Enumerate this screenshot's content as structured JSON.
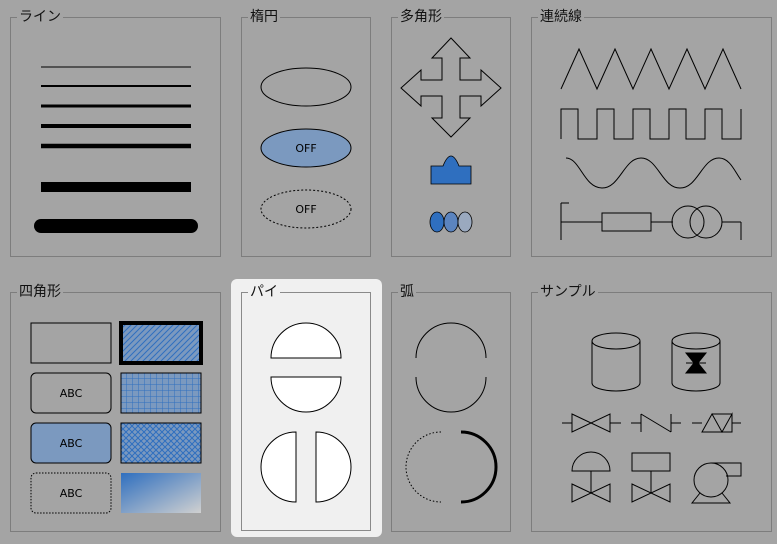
{
  "palette": {
    "background": "#a4a4a4",
    "selected_background": "#f0f0f0",
    "accent_blue": "#2f6fbf",
    "steel_blue": "#7b99bf"
  },
  "panels": {
    "line": {
      "title": "ライン"
    },
    "ellipse": {
      "title": "楕円",
      "on_fill_label": "OFF",
      "dashed_label": "OFF"
    },
    "polygon": {
      "title": "多角形"
    },
    "polyline": {
      "title": "連続線"
    },
    "rectangle": {
      "title": "四角形",
      "rounded_label": "ABC",
      "blue_label": "ABC",
      "dashed_label": "ABC"
    },
    "pie": {
      "title": "パイ",
      "selected": true
    },
    "arc": {
      "title": "弧"
    },
    "sample": {
      "title": "サンプル"
    }
  },
  "icons": {
    "polygon": [
      "four-way-arrow-icon",
      "house-shape-icon",
      "three-dots-icon"
    ],
    "polyline": [
      "zigzag-icon",
      "square-wave-icon",
      "sine-wave-icon",
      "circuit-icon"
    ],
    "sample": [
      "cylinder-tank-icon",
      "pump-tank-icon",
      "gate-valve-icon",
      "check-valve-icon",
      "relief-valve-icon",
      "diaphragm-valve-icon",
      "motor-valve-icon",
      "centrifugal-pump-icon"
    ]
  }
}
